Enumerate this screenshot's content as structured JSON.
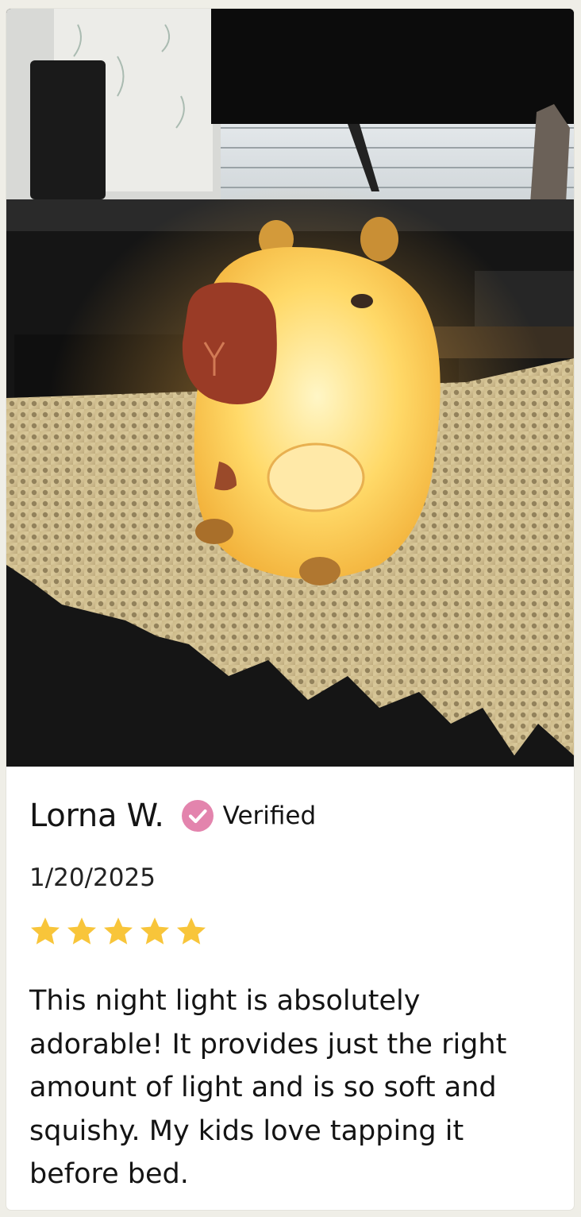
{
  "review": {
    "reviewer_name": "Lorna W.",
    "verified_label": "Verified",
    "date": "1/20/2025",
    "rating": 5,
    "rating_max": 5,
    "text": "This night light is absolutely adorable! It provides just the right amount of light and is so soft and squishy. My kids love tapping it before bed.",
    "photo": {
      "description_icon": "photo-icon"
    }
  },
  "colors": {
    "verified_badge": "#e384ad",
    "star": "#f8c53a",
    "text": "#141414"
  }
}
